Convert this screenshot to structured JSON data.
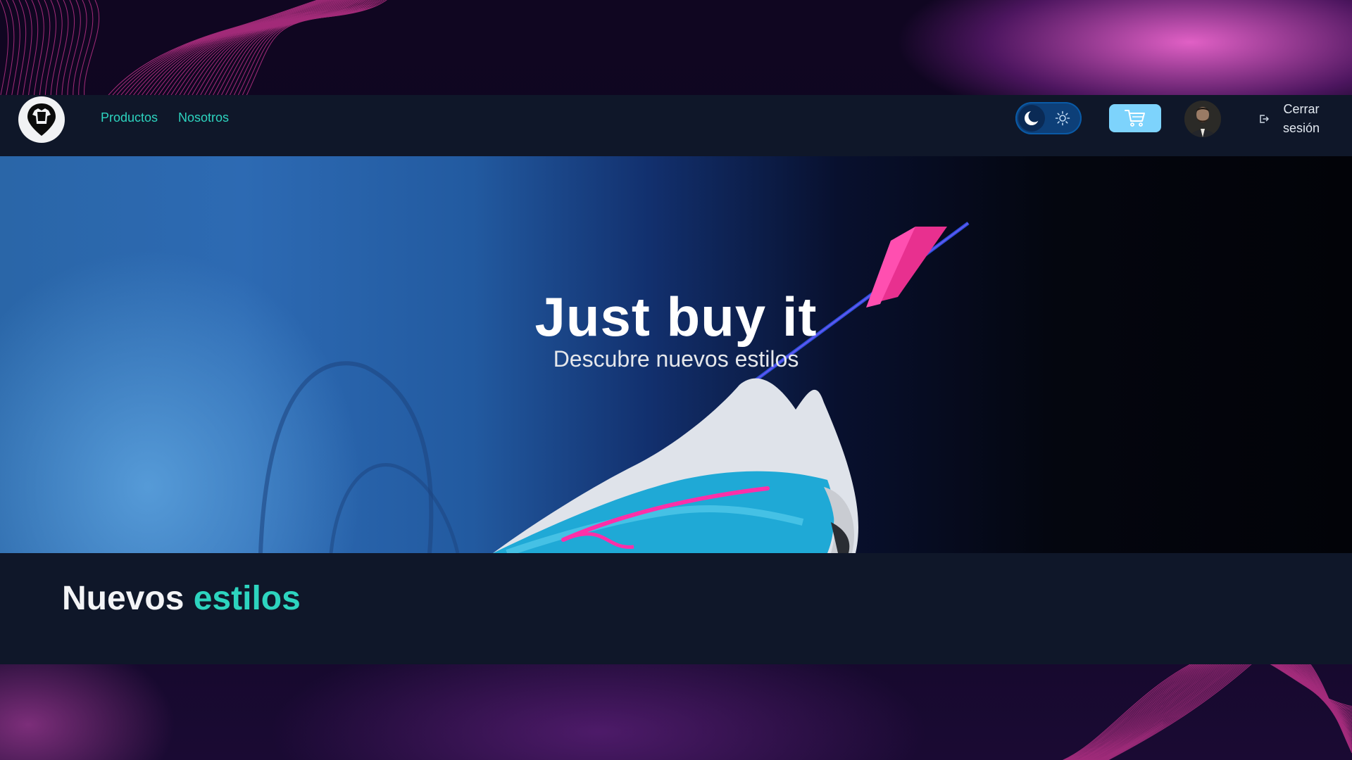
{
  "header": {
    "logo_icon": "tshirt-pin-logo",
    "nav": [
      {
        "label": "Productos"
      },
      {
        "label": "Nosotros"
      }
    ],
    "theme_toggle": {
      "mode": "dark",
      "icons": [
        "moon-icon",
        "sun-icon"
      ]
    },
    "cart_icon": "cart-icon",
    "logout_label_line1": "Cerrar",
    "logout_label_line2": "sesión"
  },
  "hero": {
    "title": "Just buy it",
    "subtitle": "Descubre nuevos estilos"
  },
  "section": {
    "title_plain": "Nuevos",
    "title_accent": "estilos"
  },
  "colors": {
    "accent": "#2dd4bf",
    "header_bg": "#0f1729",
    "cart_button": "#7dd3fc",
    "toggle_bg": "#0d3f78"
  }
}
